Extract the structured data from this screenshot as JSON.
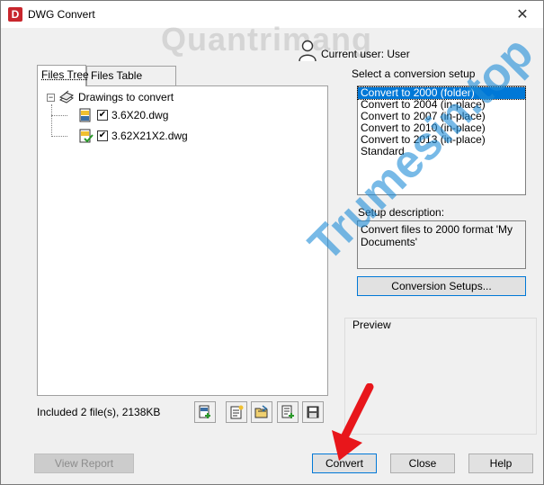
{
  "window": {
    "title": "DWG Convert",
    "app_icon_letter": "D",
    "close_glyph": "✕"
  },
  "watermarks": {
    "top": "Quantrimang",
    "diagonal": "Trumesin.top"
  },
  "user": {
    "label": "Current user: User"
  },
  "tabs": [
    {
      "label": "Files Tree",
      "active": true
    },
    {
      "label": "Files Table",
      "active": false
    }
  ],
  "tree": {
    "root_label": "Drawings to convert",
    "expander": "−",
    "files": [
      {
        "name": "3.6X20.dwg",
        "checked": true
      },
      {
        "name": "3.62X21X2.dwg",
        "checked": true
      }
    ]
  },
  "status": {
    "included": "Included 2 file(s), 2138KB"
  },
  "toolbar_icons": [
    "add-file-icon",
    "new-list-icon",
    "open-list-icon",
    "append-list-icon",
    "save-list-icon"
  ],
  "setups": {
    "label": "Select a conversion setup",
    "items": [
      "Convert to 2000 (folder)",
      "Convert to 2004 (in-place)",
      "Convert to 2007 (in-place)",
      "Convert to 2010 (in-place)",
      "Convert to 2013 (in-place)",
      "Standard"
    ],
    "selected_index": 0
  },
  "description": {
    "label": "Setup description:",
    "text": "Convert files to 2000 format 'My Documents'"
  },
  "buttons": {
    "conversion_setups": "Conversion Setups...",
    "view_report": "View Report",
    "convert": "Convert",
    "close": "Close",
    "help": "Help"
  },
  "preview": {
    "label": "Preview"
  },
  "colors": {
    "selection": "#0078d7",
    "app_icon": "#c8262c",
    "arrow": "#e8161b"
  }
}
